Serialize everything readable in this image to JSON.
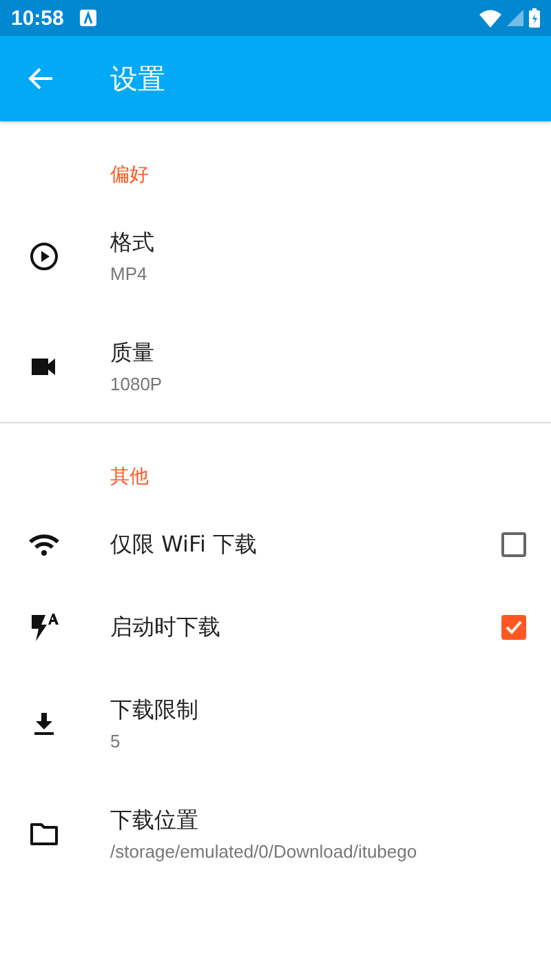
{
  "status_bar": {
    "time": "10:58"
  },
  "app_bar": {
    "title": "设置"
  },
  "sections": [
    {
      "title": "偏好",
      "items": [
        {
          "kind": "value",
          "title": "格式",
          "summary": "MP4"
        },
        {
          "kind": "value",
          "title": "质量",
          "summary": "1080P"
        }
      ]
    },
    {
      "title": "其他",
      "items": [
        {
          "kind": "checkbox",
          "title": "仅限 WiFi 下载",
          "checked": false
        },
        {
          "kind": "checkbox",
          "title": "启动时下载",
          "checked": true
        },
        {
          "kind": "value",
          "title": "下载限制",
          "summary": "5"
        },
        {
          "kind": "value",
          "title": "下载位置",
          "summary": "/storage/emulated/0/Download/itubego"
        }
      ]
    }
  ]
}
